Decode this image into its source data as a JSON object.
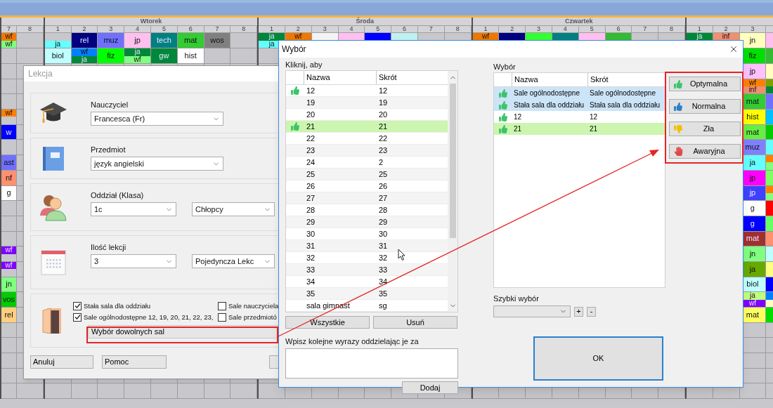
{
  "timetable": {
    "groups": [
      {
        "periods": [
          "7",
          "8"
        ]
      },
      {
        "label": "Wtorek",
        "periods": [
          "1",
          "2",
          "3",
          "4",
          "5",
          "6",
          "7",
          "8"
        ]
      },
      {
        "label": "Środa",
        "periods": [
          "1",
          "2",
          "3",
          "4",
          "5",
          "6",
          "7",
          "8"
        ]
      },
      {
        "label": "Czwartek",
        "periods": [
          "1",
          "2",
          "3",
          "4",
          "5",
          "6",
          "7",
          "8"
        ]
      },
      {
        "periods": [
          "1",
          "2",
          "3"
        ]
      }
    ],
    "top_rows": [
      {
        "cells": [
          {
            "parts": [
              {
                "text": "wf",
                "color": "#f07800"
              },
              {
                "text": "wf",
                "color": "#80ff80"
              }
            ]
          },
          null,
          {
            "text": "ja",
            "color": "#66ffff",
            "kind": "bottom-half"
          },
          {
            "text": "rel",
            "color": "#000080"
          },
          {
            "text": "muz",
            "color": "#7070ff"
          },
          {
            "text": "jp",
            "color": "#ffc0f0"
          },
          {
            "text": "tech",
            "color": "#008080"
          },
          {
            "text": "mat",
            "color": "#33cc33"
          },
          {
            "text": "wos",
            "color": "#808080"
          },
          null,
          {
            "parts": [
              {
                "text": "ja",
                "color": "#00883a"
              },
              {
                "text": "ja",
                "color": "#66ffff"
              }
            ]
          },
          {
            "text": "wf",
            "color": "#f07800",
            "kind": "top-half"
          },
          {
            "color": "#f4f4f4"
          },
          {
            "color": "#ffc0f0"
          },
          {
            "color": "#0000ff"
          },
          {
            "color": "#c0f0f0"
          },
          null,
          null,
          {
            "text": "wf",
            "color": "#f07800",
            "kind": "top-half"
          },
          {
            "color": "#000080"
          },
          {
            "color": "#33ff33"
          },
          {
            "color": "#008080"
          },
          {
            "color": "#ffc0f0"
          },
          {
            "color": "#33bb33"
          },
          null,
          null,
          {
            "text": "ja",
            "color": "#00883a",
            "kind": "top-half"
          },
          {
            "text": "inf",
            "color": "#f09070",
            "kind": "top-half"
          },
          {
            "text": "jn",
            "color": "#ffffc0"
          },
          {
            "color": "#ffc0f0"
          }
        ]
      },
      {
        "cells": [
          null,
          null,
          {
            "text": "biol",
            "color": "#c0ffff"
          },
          {
            "parts": [
              {
                "text": "wf",
                "color": "#0080ff"
              },
              {
                "text": "ja",
                "color": "#00883a"
              }
            ]
          },
          {
            "text": "fiz",
            "color": "#00ff00"
          },
          {
            "parts": [
              {
                "text": "ja",
                "color": "#00883a"
              },
              {
                "text": "wf",
                "color": "#80ff80"
              }
            ]
          },
          {
            "text": "gw",
            "color": "#00883a"
          },
          {
            "text": "hist",
            "color": "#ffffff"
          },
          null,
          null,
          null,
          null,
          null,
          null,
          null,
          null,
          null,
          null,
          null,
          null,
          null,
          null,
          null,
          null,
          null,
          null,
          null,
          null,
          {
            "text": "fiz",
            "color": "#00e000"
          },
          {
            "color": "#33bb33"
          }
        ]
      }
    ],
    "lower_rows": [
      {
        "right": [
          {
            "text": "jp",
            "color": "#ffc0ff"
          },
          {
            "color": "#ffffc0"
          }
        ]
      },
      {
        "right": [
          {
            "parts": [
              {
                "text": "wf",
                "color": "#ff8000"
              },
              {
                "text": "inf",
                "color": "#f09070"
              }
            ]
          },
          {
            "parts": [
              {
                "color": "#80a000"
              },
              {
                "color": "#00883a"
              }
            ]
          }
        ]
      },
      {
        "right": [
          {
            "text": "mat",
            "color": "#33cc33"
          },
          {
            "color": "#7070ff"
          }
        ]
      },
      {
        "left": {
          "text": "wf",
          "color": "#ff8000",
          "kind": "top-half"
        },
        "right": [
          {
            "text": "hist",
            "color": "#ffff00"
          },
          {
            "color": "#00c0ff"
          }
        ]
      },
      {
        "left": {
          "text": "w",
          "color": "#0000ff"
        },
        "right": [
          {
            "text": "mat",
            "color": "#66ee44"
          },
          {
            "color": "#00cc00"
          }
        ]
      },
      {
        "right": [
          {
            "text": "muz",
            "color": "#8080ff"
          },
          {
            "color": "#66ffff"
          }
        ]
      },
      {
        "left": {
          "text": "ast",
          "color": "#7070ff"
        },
        "right": [
          {
            "text": "ja",
            "color": "#66ffff"
          },
          {
            "parts": [
              {
                "color": "#ff8000"
              },
              {
                "color": "#80ff80"
              }
            ]
          }
        ]
      },
      {
        "left": {
          "text": "nf",
          "color": "#ff9070"
        },
        "right": [
          {
            "text": "jp",
            "color": "#ff00ff"
          },
          {
            "color": "#80ff60"
          }
        ]
      },
      {
        "left": {
          "text": "g",
          "color": "#ffffff"
        },
        "right": [
          {
            "text": "jp",
            "color": "#4040ff"
          },
          {
            "parts": [
              {
                "color": "#ff8000"
              },
              {
                "color": "#80ff80"
              }
            ]
          }
        ]
      },
      {
        "right": [
          {
            "text": "g",
            "color": "#ffffff"
          },
          {
            "color": "#ff0000"
          }
        ]
      },
      {
        "right": [
          {
            "text": "g",
            "color": "#0000ff"
          },
          {
            "color": "#66ff66"
          }
        ]
      },
      {
        "right": [
          {
            "text": "mat",
            "color": "#a03030"
          },
          {
            "color": "#ff9070"
          }
        ]
      },
      {
        "left": {
          "text": "wf",
          "color": "#8000ff",
          "kind": "top-half"
        },
        "right": [
          {
            "text": "jn",
            "color": "#80ff80"
          },
          {
            "color": "#c0ffff"
          }
        ]
      },
      {
        "left": {
          "text": "wf",
          "color": "#8000ff",
          "kind": "top-half"
        },
        "right": [
          {
            "text": "ja",
            "color": "#66aa00"
          },
          {
            "color": "#ffff80"
          }
        ]
      },
      {
        "left": {
          "text": "jn",
          "color": "#80ff80"
        },
        "right": [
          {
            "text": "biol",
            "color": "#c0ffff"
          },
          {
            "color": "#0000ff"
          }
        ]
      },
      {
        "left": {
          "text": "vos",
          "color": "#00cc00"
        },
        "right": [
          {
            "parts": [
              {
                "text": "ja",
                "color": "#c0ff80"
              },
              {
                "text": "wf",
                "color": "#8000ff"
              }
            ]
          },
          {
            "parts": [
              {
                "color": "#0080ff"
              },
              {
                "color": "#ffffc0"
              }
            ]
          }
        ]
      },
      {
        "left": {
          "text": "rel",
          "color": "#ffd080"
        },
        "right": [
          {
            "text": "mat",
            "color": "#ffff60"
          },
          {
            "color": "#00dd00"
          }
        ]
      }
    ]
  },
  "lesson_dialog": {
    "title": "Lekcja",
    "active": false,
    "sections": [
      {
        "kind": "teacher",
        "label": "Nauczyciel",
        "fields": [
          {
            "value": "Francesca (Fr)"
          }
        ]
      },
      {
        "kind": "subject",
        "label": "Przedmiot",
        "fields": [
          {
            "value": "język angielski"
          }
        ]
      },
      {
        "kind": "class",
        "label": "Oddział (Klasa)",
        "fields": [
          {
            "value": "1c"
          },
          {
            "value": "Chłopcy"
          }
        ]
      },
      {
        "kind": "count",
        "label": "Ilość lekcji",
        "fields": [
          {
            "value": "3"
          },
          {
            "value": "Pojedyncza Lekc"
          }
        ]
      }
    ],
    "rooms": {
      "checkboxes": [
        {
          "label": "Stała sala dla oddziału",
          "checked": true
        },
        {
          "label": "Sale nauczyciela",
          "checked": false
        },
        {
          "label": "Sale ogólnodostępne 12, 19, 20, 21, 22, 23,",
          "checked": true
        },
        {
          "label": "Sale przedmiotó",
          "checked": false
        }
      ],
      "button": "Wybór dowolnych sal"
    },
    "buttons": [
      "Anuluj",
      "Pomoc"
    ]
  },
  "choice_dialog": {
    "title": "Wybór",
    "hint": "Kliknij, aby",
    "columns": [
      "Nazwa",
      "Skrót"
    ],
    "rooms": [
      {
        "name": "12",
        "short": "12",
        "kind": "optimal",
        "selected": false
      },
      {
        "name": "19",
        "short": "19",
        "kind": "plain",
        "selected": false
      },
      {
        "name": "20",
        "short": "20",
        "kind": "plain",
        "selected": false
      },
      {
        "name": "21",
        "short": "21",
        "kind": "optimal",
        "selected": true
      },
      {
        "name": "22",
        "short": "22",
        "kind": "plain",
        "selected": false
      },
      {
        "name": "23",
        "short": "23",
        "kind": "plain",
        "selected": false
      },
      {
        "name": "24",
        "short": "2",
        "kind": "plain",
        "selected": false
      },
      {
        "name": "25",
        "short": "25",
        "kind": "plain",
        "selected": false
      },
      {
        "name": "26",
        "short": "26",
        "kind": "plain",
        "selected": false
      },
      {
        "name": "27",
        "short": "27",
        "kind": "plain",
        "selected": false
      },
      {
        "name": "28",
        "short": "28",
        "kind": "plain",
        "selected": false
      },
      {
        "name": "29",
        "short": "29",
        "kind": "plain",
        "selected": false
      },
      {
        "name": "30",
        "short": "30",
        "kind": "plain",
        "selected": false
      },
      {
        "name": "31",
        "short": "31",
        "kind": "plain",
        "selected": false
      },
      {
        "name": "32",
        "short": "32",
        "kind": "plain",
        "selected": false
      },
      {
        "name": "33",
        "short": "33",
        "kind": "plain",
        "selected": false
      },
      {
        "name": "34",
        "short": "34",
        "kind": "plain",
        "selected": false
      },
      {
        "name": "35",
        "short": "35",
        "kind": "plain",
        "selected": false
      },
      {
        "name": "sala gimnast",
        "short": "sg",
        "kind": "plain",
        "selected": false
      }
    ],
    "list_buttons": [
      "Wszystkie",
      "Usuń"
    ],
    "input_label": "Wpisz kolejne wyrazy oddzielając je za",
    "add_button": "Dodaj",
    "selection_label": "Wybór",
    "selection_columns": [
      "Nazwa",
      "Skrót"
    ],
    "selection": [
      {
        "name": "Sale ogólnodostępne",
        "short": "Sale ogólnodostępne",
        "kind": "optimal",
        "highlighted": true,
        "selected": false
      },
      {
        "name": "Stała sala dla oddziału",
        "short": "Stała sala dla oddziału",
        "kind": "optimal",
        "highlighted": true,
        "selected": false
      },
      {
        "name": "12",
        "short": "12",
        "kind": "optimal",
        "highlighted": false,
        "selected": false
      },
      {
        "name": "21",
        "short": "21",
        "kind": "optimal",
        "highlighted": false,
        "selected": true
      }
    ],
    "ratings": [
      {
        "label": "Optymalna",
        "kind": "optimal"
      },
      {
        "label": "Normalna",
        "kind": "normal"
      },
      {
        "label": "Zła",
        "kind": "bad"
      },
      {
        "label": "Awaryjna",
        "kind": "emergency"
      }
    ],
    "quick_label": "Szybki wybór",
    "quick_buttons": [
      "+",
      "-"
    ],
    "ok": "OK"
  }
}
